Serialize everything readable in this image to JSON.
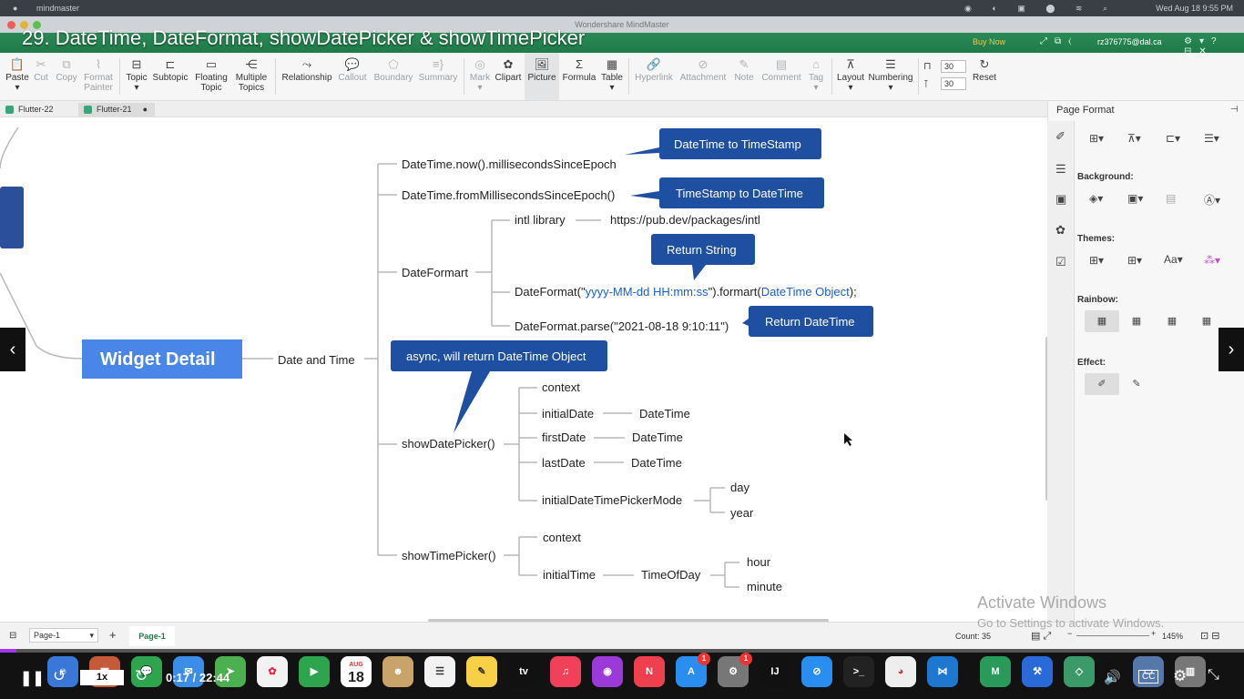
{
  "menubar": {
    "app": "mindmaster",
    "time": "Wed Aug 18  9:55 PM"
  },
  "window": {
    "title": "Wondershare MindMaster"
  },
  "video": {
    "title": "29. DateTime, DateFormat, showDatePicker & showTimePicker",
    "current": "0:17",
    "total": "22:44",
    "time_display": "0:17 / 22:44",
    "speed": "1x",
    "progress": 0.013
  },
  "header": {
    "buy_now": "Buy Now",
    "account": "rz376775@dal.ca"
  },
  "ribbon": {
    "paste": "Paste",
    "cut": "Cut",
    "copy": "Copy",
    "format_painter_1": "Format",
    "format_painter_2": "Painter",
    "topic": "Topic",
    "subtopic": "Subtopic",
    "floating_1": "Floating",
    "floating_2": "Topic",
    "multiple_1": "Multiple",
    "multiple_2": "Topics",
    "relationship": "Relationship",
    "callout": "Callout",
    "boundary": "Boundary",
    "summary": "Summary",
    "mark": "Mark",
    "clipart": "Clipart",
    "picture": "Picture",
    "formula": "Formula",
    "table": "Table",
    "hyperlink": "Hyperlink",
    "attachment": "Attachment",
    "note": "Note",
    "comment": "Comment",
    "tag": "Tag",
    "layout": "Layout",
    "numbering": "Numbering",
    "spacing_h": "30",
    "spacing_v": "30",
    "reset": "Reset"
  },
  "tabs": [
    {
      "label": "Flutter-22"
    },
    {
      "label": "Flutter-21"
    }
  ],
  "mindmap": {
    "central": "Widget Detail",
    "topic": "Date and Time",
    "n1": "DateTime.now().millisecondsSinceEpoch",
    "c1": "DateTime to TimeStamp",
    "n2": "DateTime.fromMillisecondsSinceEpoch()",
    "c2": "TimeStamp to DateTime",
    "dateformat": "DateFormart",
    "intl": "intl library",
    "intl_url": "https://pub.dev/packages/intl",
    "c3": "Return String",
    "df_a": "DateFormat(\"",
    "df_b": "yyyy-MM-dd HH:mm:ss",
    "df_c": "\").formart(",
    "df_d": "DateTime Object",
    "df_e": ");",
    "parse": "DateFormat.parse(\"2021-08-18 9:10:11\")",
    "c4": "Return DateTime",
    "c5": "async, will return DateTime Object",
    "sdp": "showDatePicker()",
    "sdp_context": "context",
    "initialDate": "initialDate",
    "firstDate": "firstDate",
    "lastDate": "lastDate",
    "dt1": "DateTime",
    "dt2": "DateTime",
    "dt3": "DateTime",
    "mode": "initialDateTimePickerMode",
    "day": "day",
    "year": "year",
    "stp": "showTimePicker()",
    "stp_context": "context",
    "initialTime": "initialTime",
    "tod": "TimeOfDay",
    "hour": "hour",
    "minute": "minute"
  },
  "panel": {
    "title": "Page Format",
    "background": "Background:",
    "themes": "Themes:",
    "rainbow": "Rainbow:",
    "effect": "Effect:",
    "font_label": "Aa"
  },
  "status": {
    "page_select": "Page-1",
    "page_tab": "Page-1",
    "count": "Count: 35",
    "zoom": "145%"
  },
  "watermark": {
    "line1": "Activate Windows",
    "line2": "Go to Settings to activate Windows."
  },
  "dock": {
    "calendar_month": "AUG",
    "calendar_day": "18",
    "badge1": "1",
    "badge2": "1"
  },
  "colors": {
    "accent_green": "#1f7a49",
    "central": "#4a86e8",
    "callout": "#1f4fa0",
    "link_blue": "#1a5fd0",
    "progress": "#a435f0"
  }
}
